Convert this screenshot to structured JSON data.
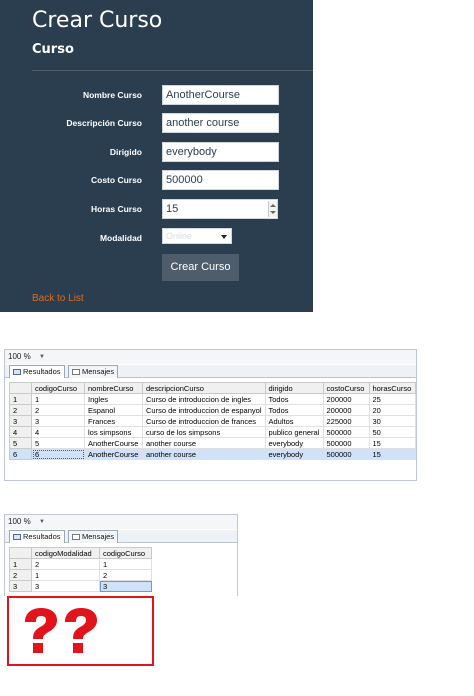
{
  "form": {
    "title": "Crear Curso",
    "subtitle": "Curso",
    "fields": [
      {
        "label": "Nombre Curso",
        "value": "AnotherCourse"
      },
      {
        "label": "Descripción Curso",
        "value": "another course"
      },
      {
        "label": "Dirigido",
        "value": "everybody"
      },
      {
        "label": "Costo Curso",
        "value": "500000"
      },
      {
        "label": "Horas Curso",
        "value": "15"
      }
    ],
    "modalidad": {
      "label": "Modalidad",
      "selected": "Online"
    },
    "submit_label": "Crear Curso",
    "back_link": "Back to List",
    "colors": {
      "background": "#2b3e50",
      "button": "#4e5d6c",
      "link": "#df691a"
    }
  },
  "results_top": {
    "zoom": "100 %",
    "tabs": [
      "Resultados",
      "Mensajes"
    ],
    "columns": [
      "codigoCurso",
      "nombreCurso",
      "descripcionCurso",
      "dirigido",
      "costoCurso",
      "horasCurso"
    ],
    "rows": [
      [
        "1",
        "1",
        "Ingles",
        "Curso de introduccion de ingles",
        "Todos",
        "200000",
        "25"
      ],
      [
        "2",
        "2",
        "Espanol",
        "Curso de introduccion de espanyol",
        "Todos",
        "200000",
        "20"
      ],
      [
        "3",
        "3",
        "Frances",
        "Curso de introduccion de frances",
        "Adultos",
        "225000",
        "30"
      ],
      [
        "4",
        "4",
        "los simpsons",
        "curso de los simpsons",
        "publico general",
        "500000",
        "50"
      ],
      [
        "5",
        "5",
        "AnotherCourse",
        "another course",
        "everybody",
        "500000",
        "15"
      ],
      [
        "6",
        "6",
        "AnotherCourse",
        "another course",
        "everybody",
        "500000",
        "15"
      ]
    ],
    "selected_row": 6
  },
  "results_bottom": {
    "zoom": "100 %",
    "tabs": [
      "Resultados",
      "Mensajes"
    ],
    "columns": [
      "codigoModalidad",
      "codigoCurso"
    ],
    "rows": [
      [
        "1",
        "2",
        "1"
      ],
      [
        "2",
        "1",
        "2"
      ],
      [
        "3",
        "3",
        "3"
      ]
    ]
  },
  "annotation": {
    "icon": "question-marks-icon",
    "color": "#e1141b"
  }
}
